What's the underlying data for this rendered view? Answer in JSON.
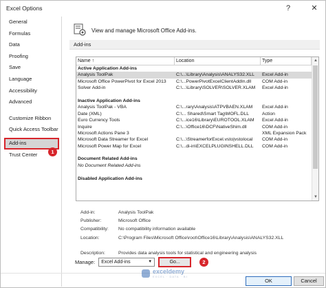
{
  "window": {
    "title": "Excel Options",
    "help_glyph": "?",
    "close_glyph": "✕"
  },
  "sidebar": {
    "items": [
      {
        "label": "General"
      },
      {
        "label": "Formulas"
      },
      {
        "label": "Data"
      },
      {
        "label": "Proofing"
      },
      {
        "label": "Save"
      },
      {
        "label": "Language"
      },
      {
        "label": "Accessibility"
      },
      {
        "label": "Advanced"
      },
      {
        "label": "Customize Ribbon"
      },
      {
        "label": "Quick Access Toolbar"
      },
      {
        "label": "Add-ins",
        "selected": true
      },
      {
        "label": "Trust Center"
      }
    ]
  },
  "badges": {
    "one": "1",
    "two": "2",
    "color": "#d7252b"
  },
  "main": {
    "header_text": "View and manage Microsoft Office Add-ins.",
    "section_title": "Add-ins",
    "columns": {
      "name": "Name ↑",
      "location": "Location",
      "type": "Type"
    },
    "groups": {
      "active": "Active Application Add-ins",
      "inactive": "Inactive Application Add-ins",
      "document": "Document Related Add-ins",
      "document_empty": "No Document Related Add-ins",
      "disabled": "Disabled Application Add-ins"
    },
    "active_rows": [
      {
        "name": "Analysis ToolPak",
        "location": "C:\\...\\Library\\Analysis\\ANALYS32.XLL",
        "type": "Excel Add-in",
        "selected": true
      },
      {
        "name": "Microsoft Office PowerPivot for Excel 2013",
        "location": "C:\\...PowerPivotExcelClientAddIn.dll",
        "type": "COM Add-in"
      },
      {
        "name": "Solver Add-in",
        "location": "C:\\...\\Library\\SOLVER\\SOLVER.XLAM",
        "type": "Excel Add-in"
      }
    ],
    "inactive_rows": [
      {
        "name": "Analysis ToolPak - VBA",
        "location": "C:\\...rary\\Analysis\\ATPVBAEN.XLAM",
        "type": "Excel Add-in"
      },
      {
        "name": "Date (XML)",
        "location": "C:\\... Shared\\Smart Tag\\MOFL.DLL",
        "type": "Action"
      },
      {
        "name": "Euro Currency Tools",
        "location": "C:\\...ice16\\Library\\EUROTOOL.XLAM",
        "type": "Excel Add-in"
      },
      {
        "name": "Inquire",
        "location": "C:\\...\\Office16\\DCF\\NativeShim.dll",
        "type": "COM Add-in"
      },
      {
        "name": "Microsoft Actions Pane 3",
        "location": "",
        "type": "XML Expansion Pack"
      },
      {
        "name": "Microsoft Data Streamer for Excel",
        "location": "C:\\...\\StreamerforExcel.vsto|vstolocal",
        "type": "COM Add-in"
      },
      {
        "name": "Microsoft Power Map for Excel",
        "location": "C:\\...di-in\\EXCELPLUGINSHELL.DLL",
        "type": "COM Add-in"
      }
    ],
    "details": {
      "addin_label": "Add-in:",
      "addin_value": "Analysis ToolPak",
      "publisher_label": "Publisher:",
      "publisher_value": "Microsoft Office",
      "compat_label": "Compatibility:",
      "compat_value": "No compatibility information available",
      "location_label": "Location:",
      "location_value": "C:\\Program Files\\Microsoft Office\\root\\Office16\\Library\\Analysis\\ANALYS32.XLL",
      "desc_label": "Description:",
      "desc_value": "Provides data analysis tools for statistical and engineering analysis"
    },
    "manage": {
      "label": "Manage:",
      "selected": "Excel Add-ins",
      "go_label": "Go..."
    }
  },
  "footer": {
    "ok_label": "OK",
    "cancel_label": "Cancel"
  },
  "watermark": {
    "name": "exceldemy",
    "tagline": "EXCEL · DATA · BI"
  }
}
